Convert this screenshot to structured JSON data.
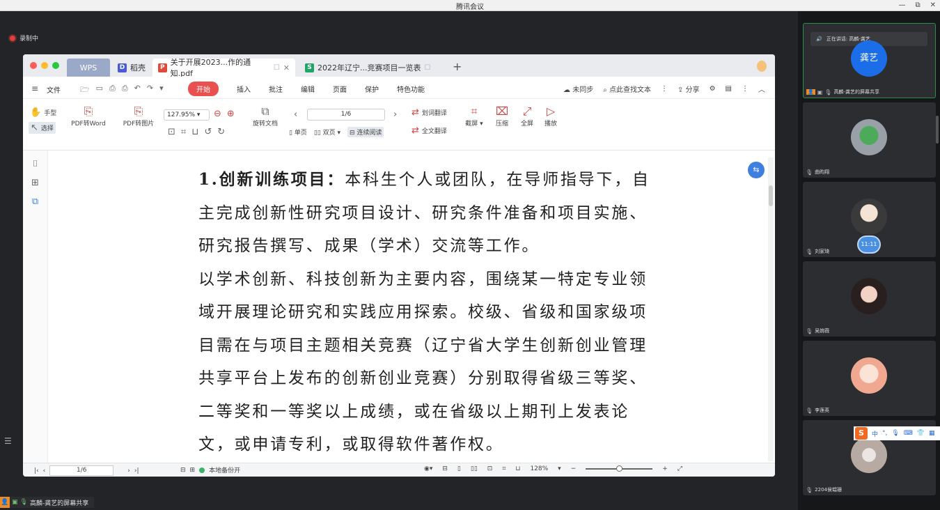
{
  "window": {
    "title": "腾讯会议",
    "controls": [
      "—",
      "⧉",
      "✕"
    ]
  },
  "meeting": {
    "recording_label": "录制中",
    "share_label": "高麟-龚艺的屏幕共享"
  },
  "wps": {
    "tabs": {
      "wps": "WPS",
      "daoke": "稻壳",
      "pdf": "关于开展2023...作的通知.pdf",
      "xls": "2022年辽宁...竞赛项目一览表"
    },
    "menu": {
      "file": "文件",
      "start": "开始",
      "insert": "插入",
      "annotate": "批注",
      "edit": "编辑",
      "page": "页面",
      "protect": "保护",
      "special": "特色功能",
      "unsynced": "未同步",
      "search": "点此查找文本",
      "share": "分享"
    },
    "ribbon": {
      "hand": "手型",
      "select": "选择",
      "pdf_to_word": "PDF转Word",
      "pdf_to_image": "PDF转图片",
      "zoom": "127.95%",
      "rotate": "旋转文档",
      "page_indicator": "1/6",
      "single": "单页",
      "double": "双页",
      "continuous": "连续阅读",
      "word_translate": "划词翻译",
      "full_translate": "全文翻译",
      "crop": "截屏",
      "compress": "压缩",
      "fullscreen": "全屏",
      "play": "播放"
    },
    "doc": {
      "heading": "1.创新训练项目：",
      "para1_rest": "本科生个人或团队，在导师指导下，自主完成创新性研究项目设计、研究条件准备和项目实施、研究报告撰写、成果（学术）交流等工作。",
      "para2": "以学术创新、科技创新为主要内容，围绕某一特定专业领域开展理论研究和实践应用探索。校级、省级和国家级项目需在与项目主题相关竞赛（辽宁省大学生创新创业管理共享平台上发布的创新创业竞赛）分别取得省级三等奖、二等奖和一等奖以上成绩，或在省级以上期刊上发表论文，或申请专利，或取得软件著作权。"
    },
    "status": {
      "page": "1/6",
      "backup": "本地备份开",
      "zoom": "128%"
    }
  },
  "participants": {
    "speaking_label": "正在讲话: 高麟-龚艺",
    "tiles": [
      {
        "avatar_text": "龚艺",
        "name": "高麟-龚艺的屏幕共享"
      },
      {
        "name": "曲昀翔"
      },
      {
        "name": "刘家琦",
        "badge": "11:11"
      },
      {
        "name": "吴婉薇"
      },
      {
        "name": "李莲英"
      },
      {
        "name": "2204侯韫珊"
      }
    ]
  },
  "ime": {
    "logo": "S",
    "mode": "中"
  },
  "colors": {
    "accent_red": "#e95050",
    "speaking_green": "#2f8d4a",
    "avatar_blue": "#1c6ee8"
  }
}
